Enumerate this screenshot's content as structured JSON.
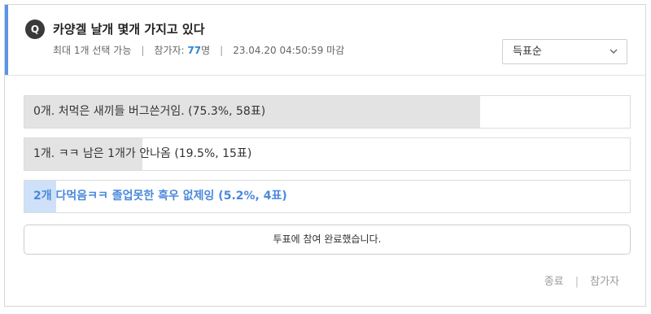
{
  "poll": {
    "badge": "Q",
    "question": "카양겔 날개 몇개 가지고 있다",
    "meta": {
      "limit": "최대 1개 선택 가능",
      "separator": "|",
      "participants_label": "참가자:",
      "participants_count": "77",
      "participants_unit": "명",
      "deadline": "23.04.20 04:50:59 마감"
    },
    "sort": {
      "selected": "득표순",
      "icon": "chevron-down-icon"
    },
    "options": [
      {
        "label": "0개. 처먹은 새끼들 버그쓴거임. (75.3%, 58표)",
        "percent": 75.3,
        "votes": 58,
        "selected": false
      },
      {
        "label": "1개. ㅋㅋ 남은 1개가 안나옴 (19.5%, 15표)",
        "percent": 19.5,
        "votes": 15,
        "selected": false
      },
      {
        "label": "2개 다먹음ㅋㅋ 졸업못한 흑우 없제잉 (5.2%, 4표)",
        "percent": 5.2,
        "votes": 4,
        "selected": true
      }
    ],
    "done_button": "투표에 참여 완료했습니다.",
    "footer": {
      "end": "종료",
      "separator": "|",
      "participants": "참가자"
    }
  },
  "colors": {
    "accent": "#5b93e6",
    "count": "#2e86d6",
    "selected_text": "#4a89dc",
    "selected_fill": "#cfe1f8",
    "bar_fill": "#e3e3e3"
  }
}
